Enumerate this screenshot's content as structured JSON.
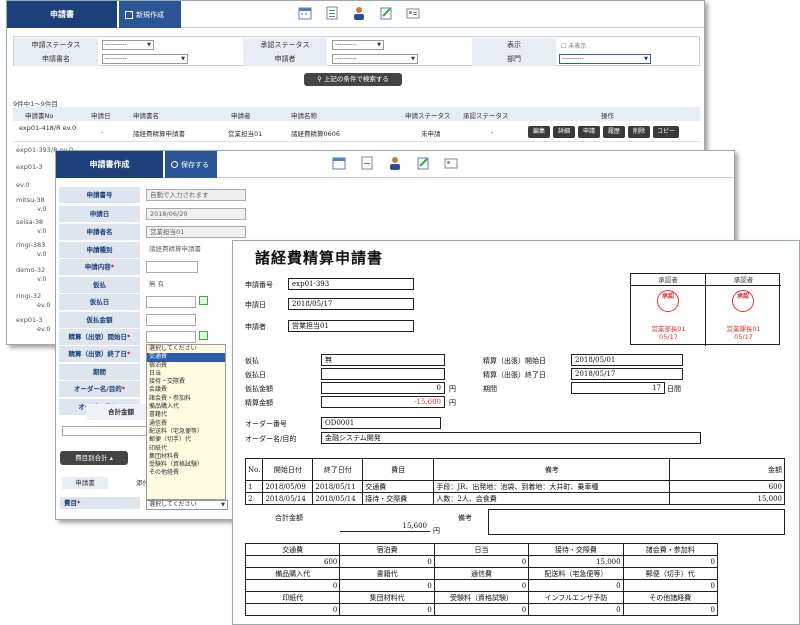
{
  "list_window": {
    "brand": "申請書",
    "new_button": "新規作成",
    "search": {
      "application_status_label": "申請ステータス",
      "application_status_value": "----------",
      "approval_status_label": "承認ステータス",
      "approval_status_value": "----------",
      "display_label": "表示",
      "unapproved_check": "未表示",
      "form_name_label": "申請書名",
      "form_name_value": "----------",
      "applicant_label": "申請者",
      "applicant_value": "----------",
      "department_label": "部門",
      "department_value": "----------",
      "search_button": "上記の条件で検索する"
    },
    "count_text": "9件中1〜9件目",
    "columns": [
      "申請書No",
      "申請日",
      "申請書名",
      "申請者",
      "申請名称",
      "申請ステータス",
      "承認ステータス",
      "操作"
    ],
    "row1": {
      "no": "exp01-418/R ev.0",
      "date": "-",
      "form": "諸経費精算申請書",
      "applicant": "営業担当01",
      "name": "諸経費精算0606",
      "status": "未申請",
      "approval": "-"
    },
    "actions": [
      "編集",
      "詳細",
      "申請",
      "履歴",
      "削除",
      "コピー"
    ],
    "side_rows": [
      "exp01-393/R ev.0",
      "2018年5月17",
      "exp01-3",
      "ev.0",
      "mitsu-38",
      "v.0",
      "seisa-38",
      "v.0",
      "ringi-383",
      "v.0",
      "demo-32",
      "v.0",
      "ringi-32",
      "ev.0",
      "exp01-3",
      "ev.0"
    ]
  },
  "edit_window": {
    "brand": "申請書作成",
    "save_button": "保存する",
    "fields": [
      {
        "label": "申請書号",
        "value": "自動で入力されます"
      },
      {
        "label": "申請日",
        "value": "2018/06/20"
      },
      {
        "label": "申請者名",
        "value": "営業担当01"
      },
      {
        "label": "申請種別",
        "value": "諸経費精算申請書"
      },
      {
        "label": "申請内容",
        "value": ""
      },
      {
        "label": "仮払",
        "value": "無  有"
      },
      {
        "label": "仮払日",
        "value": ""
      },
      {
        "label": "仮払金額",
        "value": ""
      },
      {
        "label": "精算（出張）開始日",
        "value": ""
      },
      {
        "label": "精算（出張）終了日",
        "value": ""
      },
      {
        "label": "期間",
        "value": ""
      },
      {
        "label": "オーダー名/目的",
        "value": ""
      },
      {
        "label": "オーダー番号",
        "value": ""
      }
    ],
    "total_label": "合計金額",
    "expense_button": "費目別合計",
    "tab_request": "申請書",
    "tab_attach": "添付ファ",
    "item_label": "費目",
    "item_select": "選択してください",
    "dropdown": [
      "選択してください",
      "交通費",
      "宿泊費",
      "日当",
      "接待・交際費",
      "会議費",
      "諸会費・参加料",
      "備品購入代",
      "書籍代",
      "通信費",
      "配送料（宅急便等）",
      "郵便（切手）代",
      "印紙代",
      "集団材料費",
      "受験料（資格試験）",
      "その他経費"
    ]
  },
  "doc": {
    "title": "諸経費精算申請書",
    "app_no_label": "申請番号",
    "app_no": "exp01-393",
    "app_date_label": "申請日",
    "app_date": "2018/05/17",
    "applicant_label": "申請者",
    "applicant": "営業担当01",
    "approvals": [
      {
        "role": "承認者",
        "seal": "承認",
        "name": "営業部長01",
        "date": "05/17"
      },
      {
        "role": "承認者",
        "seal": "承認",
        "name": "営業課長01",
        "date": "05/17"
      }
    ],
    "advance_label": "仮払",
    "advance": "無",
    "advance_date_label": "仮払日",
    "advance_date": "",
    "advance_amount_label": "仮払金額",
    "advance_amount": "0",
    "settle_amount_label": "精算金額",
    "settle_amount": "-15,600",
    "yen": "円",
    "start_label": "精算（出張）開始日",
    "start": "2018/05/01",
    "end_label": "精算（出張）終了日",
    "end": "2018/05/17",
    "period_label": "期間",
    "period": "17",
    "period_unit": "日間",
    "order_no_label": "オーダー番号",
    "order_no": "OD0001",
    "order_name_label": "オーダー名/目的",
    "order_name": "金融システム開発",
    "detail_head": [
      "No.",
      "開始日付",
      "終了日付",
      "費目",
      "備考",
      "金額"
    ],
    "details": [
      [
        "1",
        "2018/05/09",
        "2018/05/11",
        "交通費",
        "手段：JR、出発地：池袋、到着地：大井町、乗車種",
        "600"
      ],
      [
        "2",
        "2018/05/14",
        "2018/05/14",
        "接待・交際費",
        "人数：2人、会食費",
        "15,000"
      ]
    ],
    "total_label": "合計金額",
    "total": "15,600",
    "total_yen": "円",
    "remarks_label": "備考",
    "summary": [
      [
        [
          "交通費",
          "600"
        ],
        [
          "宿泊費",
          "0"
        ],
        [
          "日当",
          "0"
        ],
        [
          "接待・交際費",
          "15,000"
        ],
        [
          "諸会費・参加料",
          "0"
        ]
      ],
      [
        [
          "備品購入代",
          "0"
        ],
        [
          "書籍代",
          "0"
        ],
        [
          "通信費",
          "0"
        ],
        [
          "配送料（宅急便等）",
          "0"
        ],
        [
          "郵便（切手）代",
          "0"
        ]
      ],
      [
        [
          "印紙代",
          "0"
        ],
        [
          "集団材料代",
          "0"
        ],
        [
          "受験料（資格試験）",
          "0"
        ],
        [
          "インフルエンザ予防",
          "0"
        ],
        [
          "その他諸経費",
          "0"
        ]
      ]
    ]
  }
}
